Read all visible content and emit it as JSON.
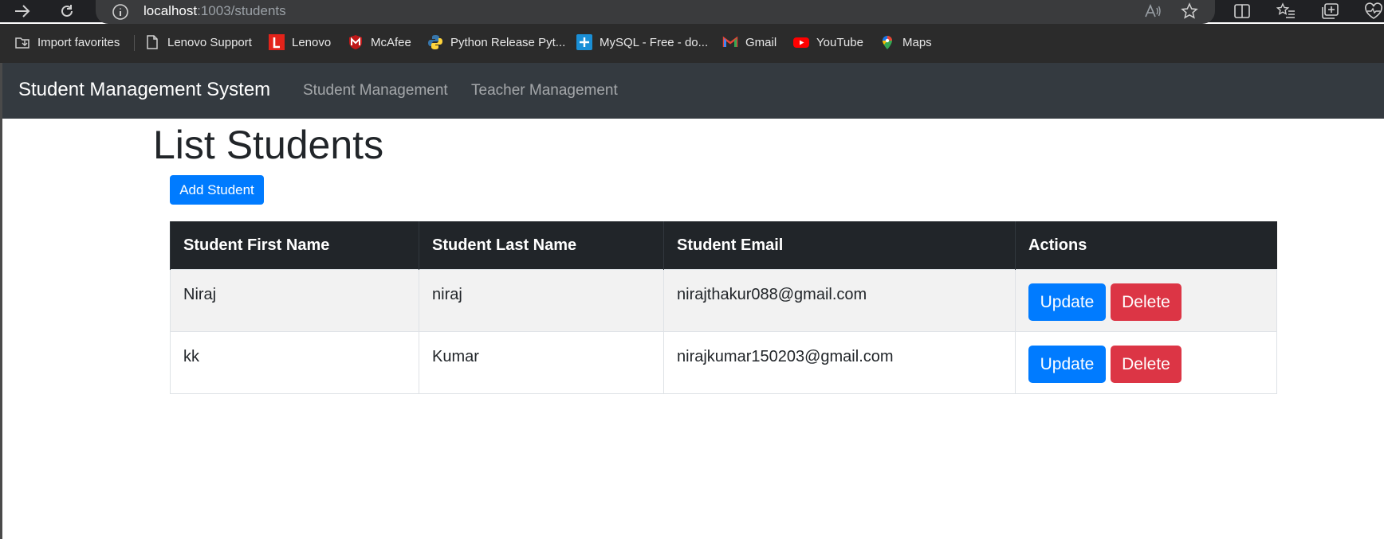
{
  "browser": {
    "url_host": "localhost",
    "url_path": ":1003/students",
    "bookmarks": [
      {
        "label": "Import favorites",
        "icon": "import-favorites-icon"
      },
      {
        "label": "Lenovo Support",
        "icon": "page-icon"
      },
      {
        "label": "Lenovo",
        "icon": "lenovo-icon"
      },
      {
        "label": "McAfee",
        "icon": "mcafee-icon"
      },
      {
        "label": "Python Release Pyt...",
        "icon": "python-icon"
      },
      {
        "label": "MySQL - Free - do...",
        "icon": "mysql-icon"
      },
      {
        "label": "Gmail",
        "icon": "gmail-icon"
      },
      {
        "label": "YouTube",
        "icon": "youtube-icon"
      },
      {
        "label": "Maps",
        "icon": "maps-icon"
      }
    ]
  },
  "navbar": {
    "brand": "Student Management System",
    "links": [
      "Student Management",
      "Teacher Management"
    ]
  },
  "main": {
    "title": "List Students",
    "add_button": "Add Student",
    "table": {
      "headers": [
        "Student First Name",
        "Student Last Name",
        "Student Email",
        "Actions"
      ],
      "rows": [
        {
          "first": "Niraj",
          "last": "niraj",
          "email": "nirajthakur088@gmail.com"
        },
        {
          "first": "kk",
          "last": "Kumar",
          "email": "nirajkumar150203@gmail.com"
        }
      ],
      "update_label": "Update",
      "delete_label": "Delete"
    }
  },
  "colors": {
    "primary": "#007bff",
    "danger": "#dc3545",
    "navbar": "#343a40",
    "table_header": "#212529"
  }
}
